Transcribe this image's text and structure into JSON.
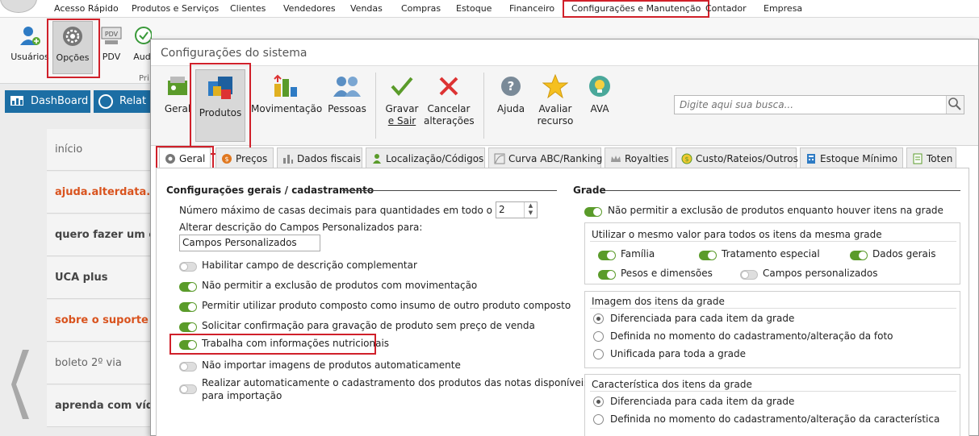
{
  "menu": {
    "items": [
      "Acesso Rápido",
      "Produtos e Serviços",
      "Clientes",
      "Vendedores",
      "Vendas",
      "Compras",
      "Estoque",
      "Financeiro",
      "Configurações e Manutenção",
      "Contador",
      "Empresa"
    ]
  },
  "ribbon": {
    "usuarios": "Usuários",
    "opcoes": "Opções",
    "pdv": "PDV",
    "pdv_icon": "PDV",
    "aud": "Aud",
    "group_fragment": "Pri"
  },
  "left": {
    "dashboard": "DashBoard",
    "relat": "Relat",
    "items": [
      "início",
      "ajuda.alterdata.com",
      "quero fazer um cu",
      "UCA plus",
      "sobre o suporte",
      "boleto 2º via",
      "aprenda com víde"
    ]
  },
  "dialog": {
    "title": "Configurações do sistema",
    "toolbar": {
      "geral": "Geral",
      "produtos": "Produtos",
      "movimentacao": "Movimentação",
      "pessoas": "Pessoas",
      "gravar_l1": "Gravar",
      "gravar_l2": "e Sair",
      "cancelar_l1": "Cancelar",
      "cancelar_l2": "alterações",
      "ajuda": "Ajuda",
      "avaliar_l1": "Avaliar",
      "avaliar_l2": "recurso",
      "ava": "AVA"
    },
    "search": {
      "placeholder": "Digite aqui sua busca..."
    },
    "tabs": [
      "Geral",
      "Preços",
      "Dados fiscais",
      "Localização/Códigos",
      "Curva ABC/Ranking",
      "Royalties",
      "Custo/Rateios/Outros",
      "Estoque Mínimo",
      "Toten"
    ]
  },
  "general": {
    "section_title": "Configurações gerais / cadastramento",
    "decimal_label": "Número máximo de casas decimais para quantidades em todo o sistema",
    "decimal_value": "2",
    "alter_label": "Alterar descrição do Campos Personalizados para:",
    "alter_value": "Campos Personalizados",
    "toggles": [
      {
        "label": "Habilitar campo de descrição complementar",
        "on": false
      },
      {
        "label": "Não permitir a exclusão de produtos com movimentação",
        "on": true
      },
      {
        "label": "Permitir utilizar produto composto como insumo de outro produto composto",
        "on": true
      },
      {
        "label": "Solicitar confirmação para gravação de produto sem preço de venda",
        "on": true
      },
      {
        "label": "Trabalha com informações nutricionais",
        "on": true
      },
      {
        "label": "Não importar imagens de produtos automaticamente",
        "on": false
      }
    ],
    "last_toggle_l1": "Realizar automaticamente o cadastramento dos produtos das notas disponíveis",
    "last_toggle_l2": "para importação"
  },
  "grade": {
    "section_title": "Grade",
    "no_delete": "Não permitir a exclusão de produtos enquanto houver itens na grade",
    "same_value_title": "Utilizar o mesmo valor para todos os itens da mesma grade",
    "familia": "Família",
    "tratamento": "Tratamento especial",
    "dados_gerais": "Dados gerais",
    "pesos": "Pesos e dimensões",
    "campos": "Campos personalizados",
    "imagem_title": "Imagem dos itens da grade",
    "imagem_opts": [
      "Diferenciada para cada item da grade",
      "Definida no momento do cadastramento/alteração da foto",
      "Unificada para toda a grade"
    ],
    "carac_title": "Característica dos itens da grade",
    "carac_opts": [
      "Diferenciada para cada item da grade",
      "Definida no momento do cadastramento/alteração da característica"
    ]
  },
  "colors": {
    "highlight": "#d0202a",
    "toggle_on": "#5a9b2a",
    "dash_blue": "#1c6ea4",
    "link_orange": "#d9531e"
  }
}
